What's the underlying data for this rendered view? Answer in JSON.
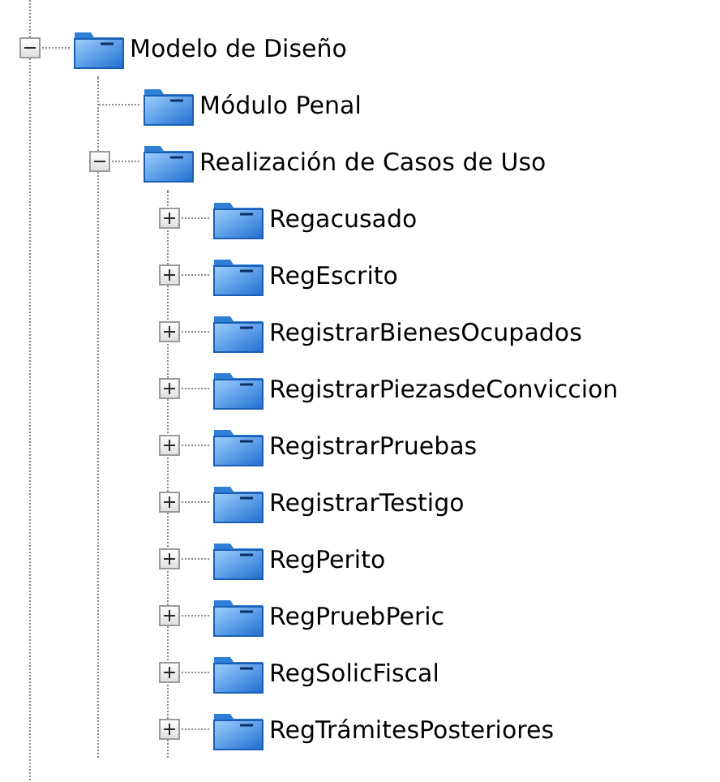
{
  "tree": [
    {
      "label": "Modelo de Diseño",
      "expanded": true,
      "children": [
        {
          "label": "Módulo Penal"
        },
        {
          "label": "Realización de Casos de Uso",
          "expanded": true,
          "children": [
            {
              "label": "Regacusado",
              "expanded": false
            },
            {
              "label": "RegEscrito",
              "expanded": false
            },
            {
              "label": "RegistrarBienesOcupados",
              "expanded": false
            },
            {
              "label": "RegistrarPiezasdeConviccion",
              "expanded": false
            },
            {
              "label": "RegistrarPruebas",
              "expanded": false
            },
            {
              "label": "RegistrarTestigo",
              "expanded": false
            },
            {
              "label": "RegPerito",
              "expanded": false
            },
            {
              "label": "RegPruebPeric",
              "expanded": false
            },
            {
              "label": "RegSolicFiscal",
              "expanded": false
            },
            {
              "label": "RegTrámitesPosteriores",
              "expanded": false
            }
          ]
        }
      ]
    }
  ]
}
